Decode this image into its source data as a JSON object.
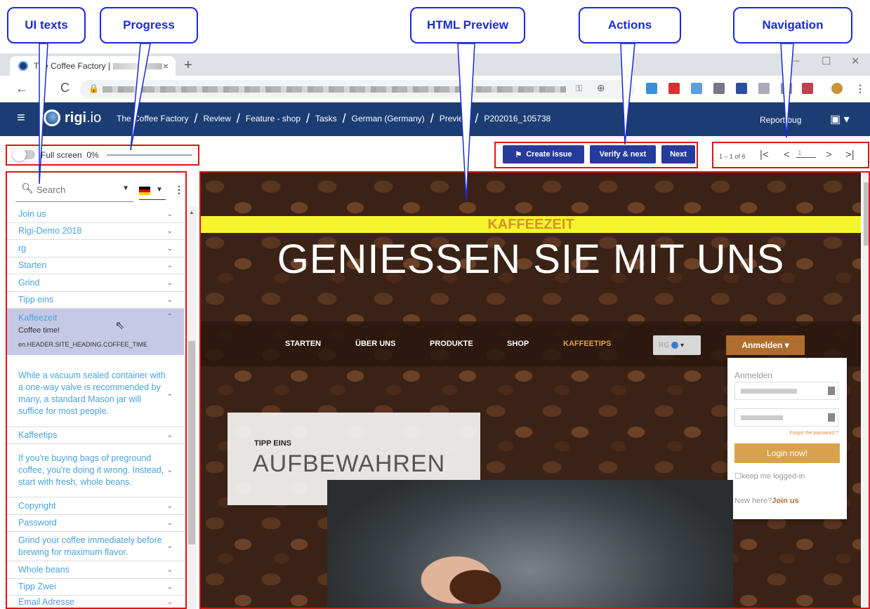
{
  "callouts": {
    "ui_texts": "UI texts",
    "progress": "Progress",
    "html_preview": "HTML Preview",
    "actions": "Actions",
    "navigation": "Navigation"
  },
  "browser": {
    "tab_title": "The Coffee Factory |",
    "tab_close": "×",
    "new_tab": "+",
    "back": "←",
    "reload": "C",
    "win_minimize": "–",
    "win_maximize": "☐",
    "win_close": "✕"
  },
  "header": {
    "logo_text": "rigi",
    "logo_suffix": ".io",
    "breadcrumbs": [
      "The Coffee Factory",
      "Review",
      "Feature - shop",
      "Tasks",
      "German (Germany)",
      "Preview",
      "P202016_105738"
    ],
    "report_bug": "Report bug"
  },
  "toolbar": {
    "fullscreen_label": "Full screen",
    "progress_value": "0%",
    "create_issue": "Create issue",
    "verify_next": "Verify & next",
    "next": "Next",
    "page_range": "1 – 1 of 6",
    "page_input": "1",
    "first": "|<",
    "prev": "<",
    "nextp": ">",
    "last": ">|"
  },
  "sidebar": {
    "search_placeholder": "Search",
    "items": [
      {
        "label": "Join us"
      },
      {
        "label": "Rigi-Demo 2018"
      },
      {
        "label": "rg"
      },
      {
        "label": "Starten"
      },
      {
        "label": "Grind"
      },
      {
        "label": "Tipp eins"
      }
    ],
    "active": {
      "label": "Kaffeezeit",
      "source": "Coffee time!",
      "key": "en.HEADER.SITE_HEADING.COFFEE_TIME"
    },
    "items_after": [
      {
        "label": "While a vacuum sealed container with a one-way valve is recommended by many, a standard Mason jar will suffice for most people."
      },
      {
        "label": "Kaffeetips"
      },
      {
        "label": "If you're buying bags of preground coffee, you're doing it wrong. Instead, start with fresh, whole beans."
      },
      {
        "label": "Copyright"
      },
      {
        "label": "Password"
      },
      {
        "label": "Grind your coffee immediately before brewing for maximum flavor."
      },
      {
        "label": "Whole beans"
      },
      {
        "label": "Tipp Zwei"
      },
      {
        "label": "Email Adresse"
      }
    ]
  },
  "preview": {
    "banner": "KAFFEEZEIT",
    "hero": "GENIESSEN SIE MIT UNS",
    "nav": [
      "STARTEN",
      "ÜBER UNS",
      "PRODUKTE",
      "SHOP",
      "KAFFEETIPS"
    ],
    "lang_select": "RG",
    "anmelden_btn": "Anmelden",
    "login_heading": "Anmelden",
    "forgot": "Forgot the password ?",
    "login_now": "Login now!",
    "keep_logged": "keep me logged-in",
    "new_here": "New here?",
    "join_us": "Join us",
    "tip_small": "TIPP EINS",
    "tip_big": "AUFBEWAHREN"
  },
  "colors": {
    "header_bg": "#1c3d74",
    "button_bg": "#253c9c",
    "banner_bg": "#f5f52e",
    "accent_orange": "#d9902a",
    "highlight_red": "#e01414",
    "callout_blue": "#1a2bd6"
  }
}
